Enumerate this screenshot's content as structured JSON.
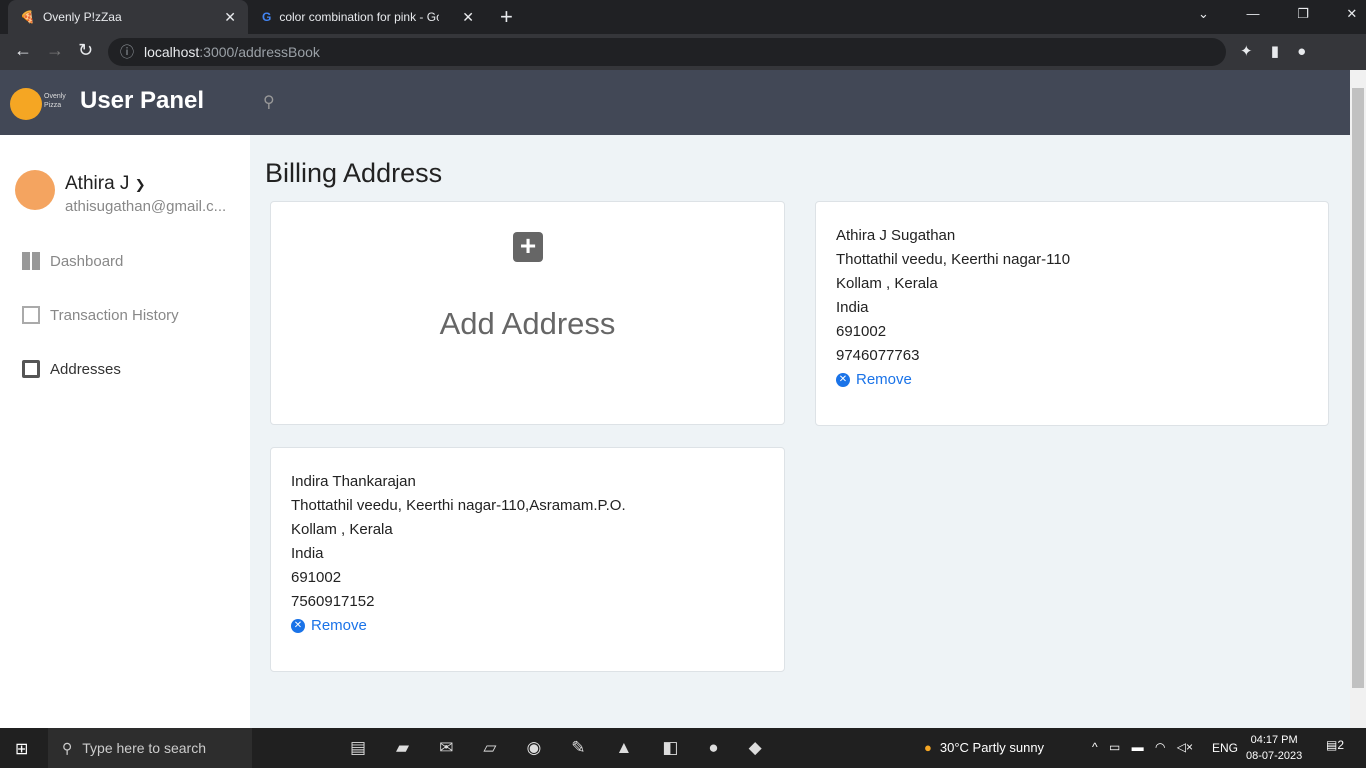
{
  "browser": {
    "tabs": [
      {
        "title": "Ovenly P!zZaa",
        "active": true
      },
      {
        "title": "color combination for pink - Goo",
        "active": false
      }
    ],
    "url_host": "localhost",
    "url_path": ":3000/addressBook"
  },
  "header": {
    "title": "User Panel",
    "logo_text": "Ovenly Pizza"
  },
  "user": {
    "name": "Athira J",
    "email": "athisugathan@gmail.c..."
  },
  "sidebar": {
    "items": [
      {
        "label": "Dashboard",
        "icon": "dashboard-icon"
      },
      {
        "label": "Transaction History",
        "icon": "grid-icon"
      },
      {
        "label": "Addresses",
        "icon": "library-books-icon"
      }
    ]
  },
  "main": {
    "title": "Billing Address",
    "add_label": "Add Address",
    "remove_label": "Remove",
    "addresses": [
      {
        "name": "Athira J Sugathan",
        "line1": "Thottathil veedu, Keerthi nagar-110",
        "city": "Kollam , Kerala",
        "country": "India",
        "pin": "691002",
        "phone": "9746077763"
      },
      {
        "name": "Indira Thankarajan",
        "line1": "Thottathil veedu, Keerthi nagar-110,Asramam.P.O.",
        "city": "Kollam , Kerala",
        "country": "India",
        "pin": "691002",
        "phone": "7560917152"
      }
    ]
  },
  "taskbar": {
    "search_placeholder": "Type here to search",
    "weather": "30°C  Partly sunny",
    "lang": "ENG",
    "time": "04:17 PM",
    "date": "08-07-2023",
    "notifications": "2"
  },
  "colors": {
    "header": "#424856",
    "accent": "#1a73e8"
  }
}
